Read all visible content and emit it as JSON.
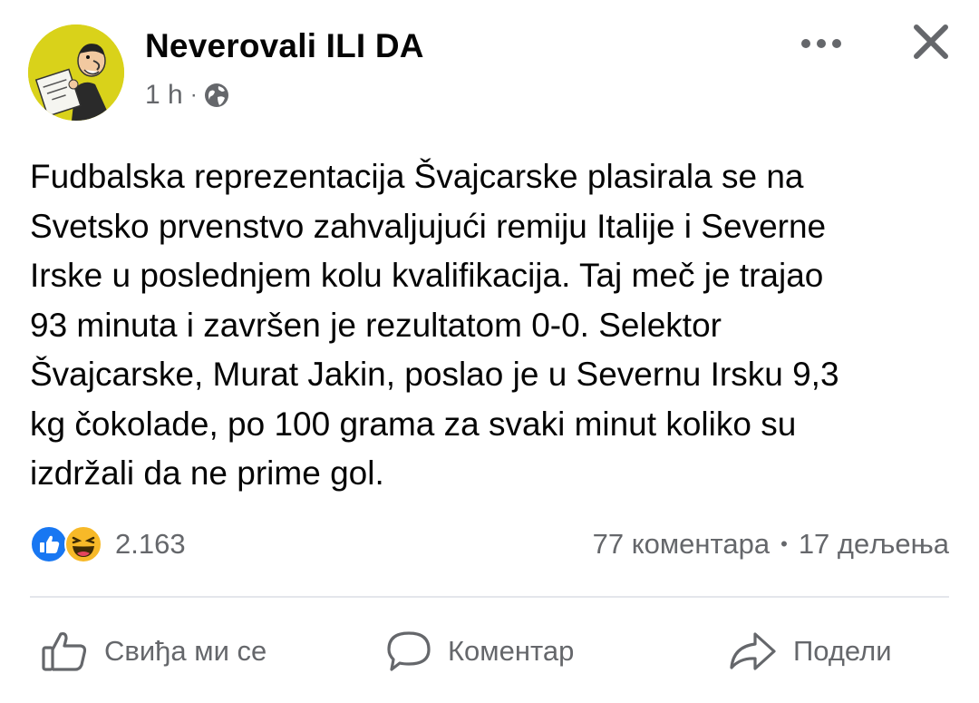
{
  "header": {
    "page_name": "Neverovali ILI DA",
    "time": "1 h",
    "separator": "·",
    "privacy_icon": "globe-icon",
    "more_icon": "more-dots-icon",
    "close_icon": "close-icon"
  },
  "post": {
    "text": "Fudbalska reprezentacija Švajcarske plasirala se na\nSvetsko prvenstvo zahvaljujući remiju Italije i Severne\nIrske u poslednjem kolu kvalifikacija. Taj meč je trajao\n93 minuta i  završen je rezultatom 0-0. Selektor\nŠvajcarske, Murat Jakin, poslao je u Severnu Irsku 9,3\nkg čokolade, po 100 grama za svaki minut koliko su\nizdržali da ne prime gol."
  },
  "engagement": {
    "reaction_icons": [
      "like-reaction-icon",
      "haha-reaction-icon"
    ],
    "reaction_count": "2.163",
    "comments": "77 коментара",
    "separator": "•",
    "shares": "17 дељења"
  },
  "actions": {
    "like_label": "Свиђа ми се",
    "comment_label": "Коментар",
    "share_label": "Подели"
  },
  "colors": {
    "text_primary": "#050505",
    "text_secondary": "#65676b",
    "like_blue": "#1877f2",
    "haha_yellow": "#f7b928",
    "divider": "#e4e6eb",
    "avatar_bg": "#d9d21a"
  }
}
